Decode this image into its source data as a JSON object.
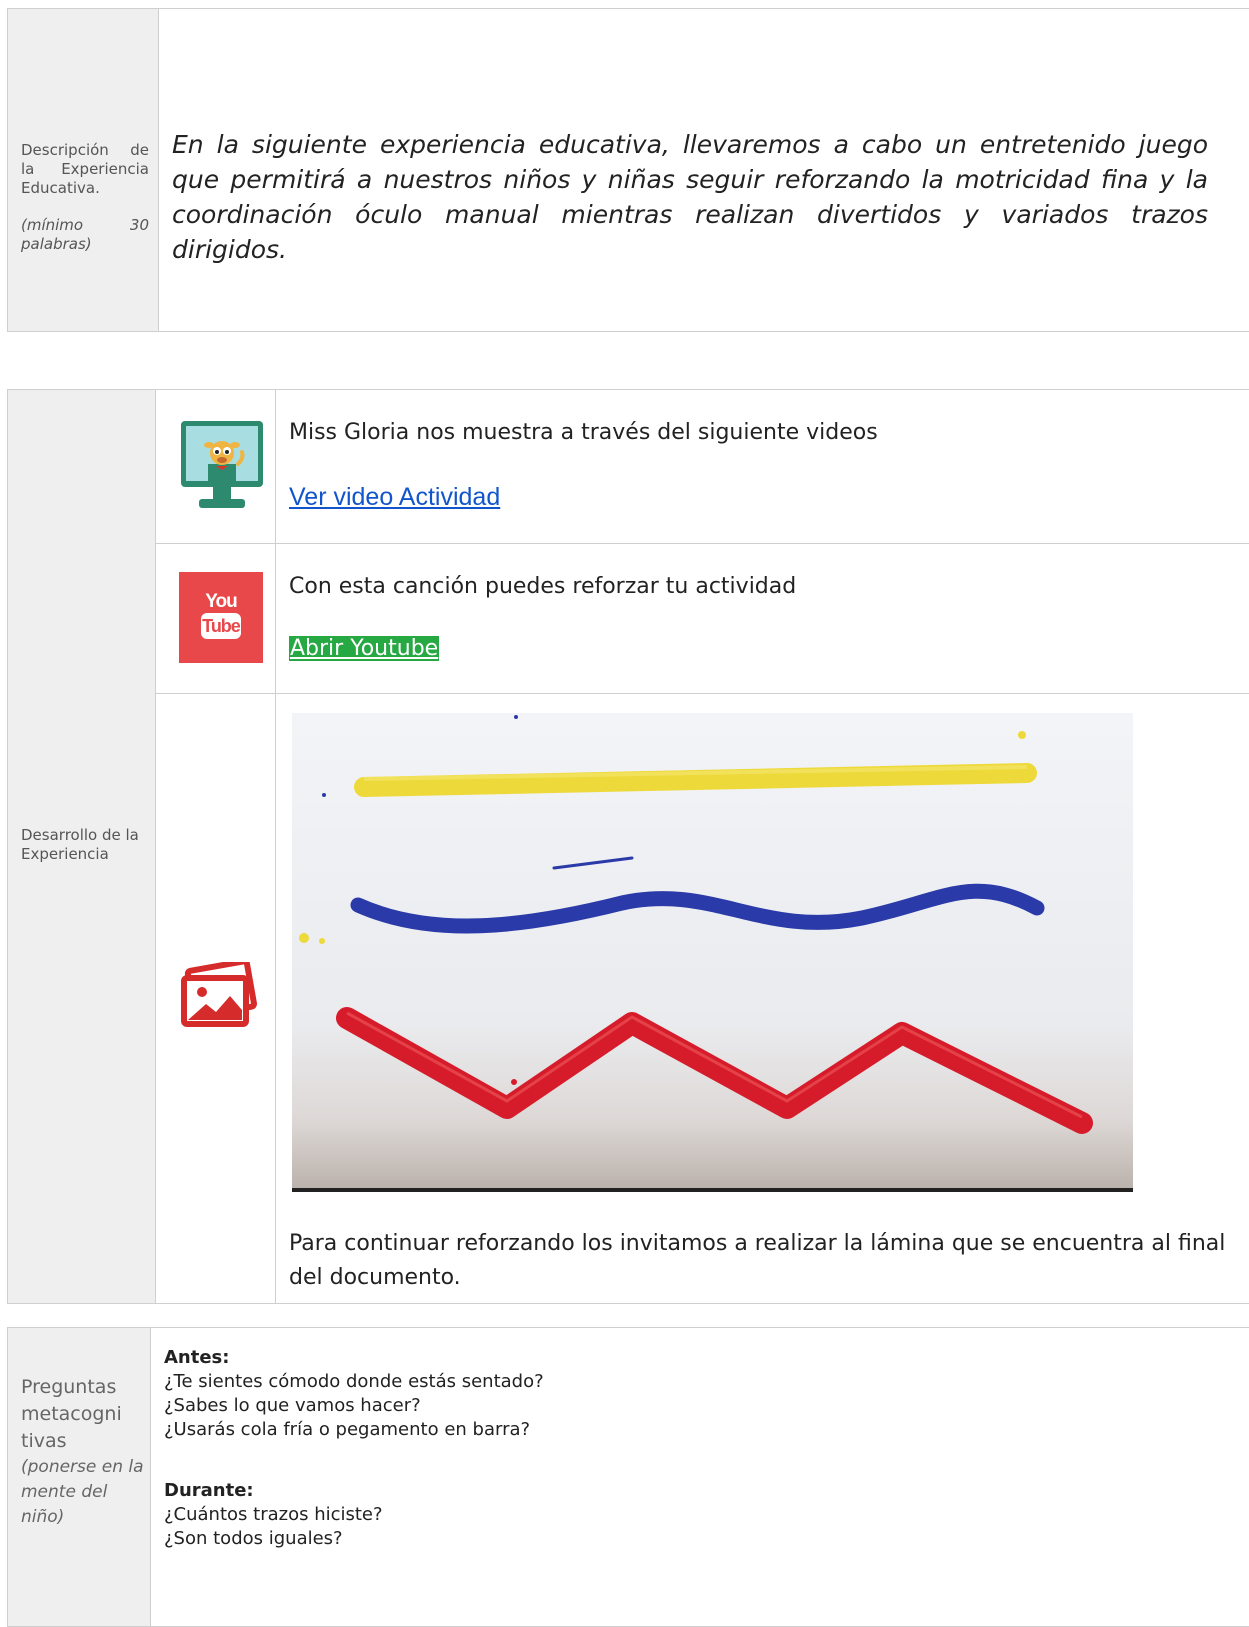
{
  "description_section": {
    "label": "Descripción de la Experiencia Educativa.",
    "label_note": "(mínimo 30 palabras)",
    "text": "En la siguiente experiencia educativa, llevaremos a cabo un entretenido juego que permitirá a nuestros niños y niñas seguir reforzando la motricidad fina y la coordinación óculo manual mientras realizan divertidos y variados trazos dirigidos."
  },
  "development_section": {
    "label": "Desarrollo de la Experiencia",
    "video_row": {
      "icon": "monitor-cartoon-icon",
      "text": "Miss Gloria nos muestra  a través del siguiente videos",
      "link": "Ver video Actividad"
    },
    "youtube_row": {
      "icon": "youtube-icon",
      "icon_text_top": "You",
      "icon_text_bottom": "Tube",
      "text": "Con esta canción puedes reforzar tu actividad",
      "link": "Abrir Youtube"
    },
    "image_row": {
      "icon": "photo-gallery-icon",
      "caption": "Para continuar reforzando los invitamos a realizar la lámina que se encuentra al final del documento."
    }
  },
  "metacognitive_section": {
    "label_main": "Preguntas metacogni tivas",
    "label_note": "(ponerse en la mente del niño)",
    "before_heading": "Antes:",
    "before_questions": [
      "¿Te sientes cómodo donde estás sentado?",
      "¿Sabes lo que vamos hacer?",
      "¿Usarás cola fría o pegamento en barra?"
    ],
    "during_heading": "Durante:",
    "during_questions": [
      "¿Cuántos trazos hiciste?",
      "¿Son todos iguales?"
    ]
  },
  "colors": {
    "label_bg": "#efefef",
    "link_blue": "#1155cc",
    "link_green_bg": "#26a843",
    "youtube_red": "#e8484a",
    "paint_yellow": "#eed93a",
    "paint_blue": "#2a3aa8",
    "paint_red": "#d61c2a"
  }
}
